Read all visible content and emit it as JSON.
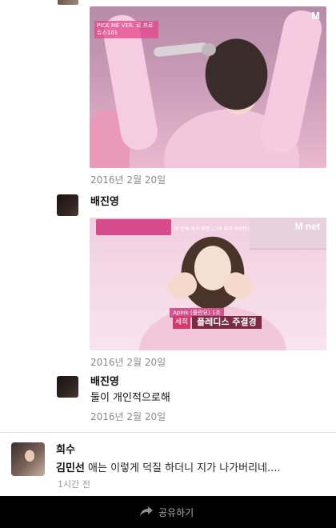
{
  "posts": [
    {
      "date": "2016년 2월 20일"
    },
    {
      "date": "2016년 2월 20일"
    }
  ],
  "comments": [
    {
      "user": "배진영"
    },
    {
      "user": "배진영",
      "text": "둘이 개인적으로해",
      "date": "2016년 2월 20일"
    }
  ],
  "photo1_overlay": {
    "logo": "M",
    "caption": "PICK ME VER. 로 프로듀스101"
  },
  "photo2_overlay": {
    "logo": "M net",
    "top_subtitle": "첫 번째 평가 배정 (그래 최대 배정중)",
    "agency": "Apink (플란요) 1조",
    "name_tag": "세희",
    "name": "플레디스 주결경"
  },
  "notification": {
    "title": "희수",
    "name": "김민선",
    "message": "애는 이렇게 덕질 하더니 지가 나가버리네....",
    "time": "1시간 전"
  },
  "sharebar": {
    "label": "공유하기"
  }
}
